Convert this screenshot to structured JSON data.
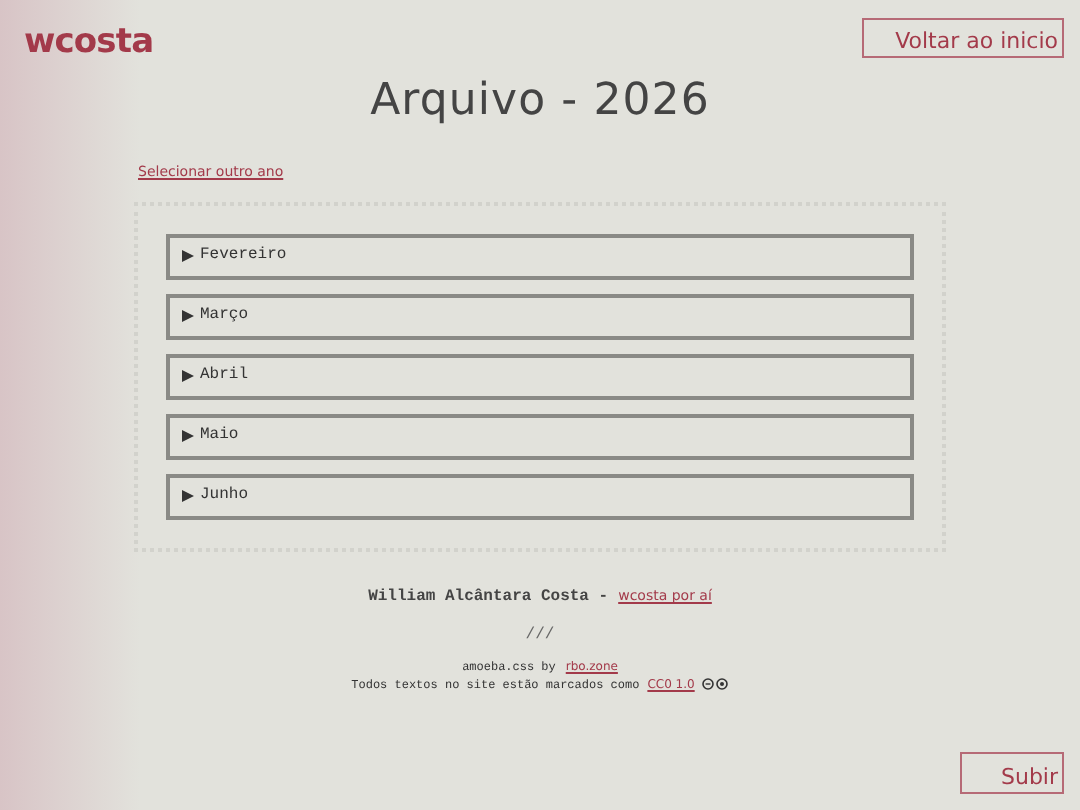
{
  "logo": "wcosta",
  "home_button": "Voltar ao inicio",
  "title": "Arquivo - 2026",
  "year_link": "Selecionar outro ano",
  "months": [
    {
      "label": "Fevereiro",
      "expanded": false
    },
    {
      "label": "Março",
      "expanded": false
    },
    {
      "label": "Abril",
      "expanded": false
    },
    {
      "label": "Maio",
      "expanded": false
    },
    {
      "label": "Junho",
      "expanded": false
    }
  ],
  "footer": {
    "author": "William Alcântara Costa -",
    "author_link": "wcosta por aí",
    "separator": "///",
    "credit": "amoeba.css by",
    "credit_link": "rbo.zone",
    "license_text": "Todos textos no site estão marcados como",
    "license_link": "CC0 1.0"
  },
  "top_button": "Subir"
}
